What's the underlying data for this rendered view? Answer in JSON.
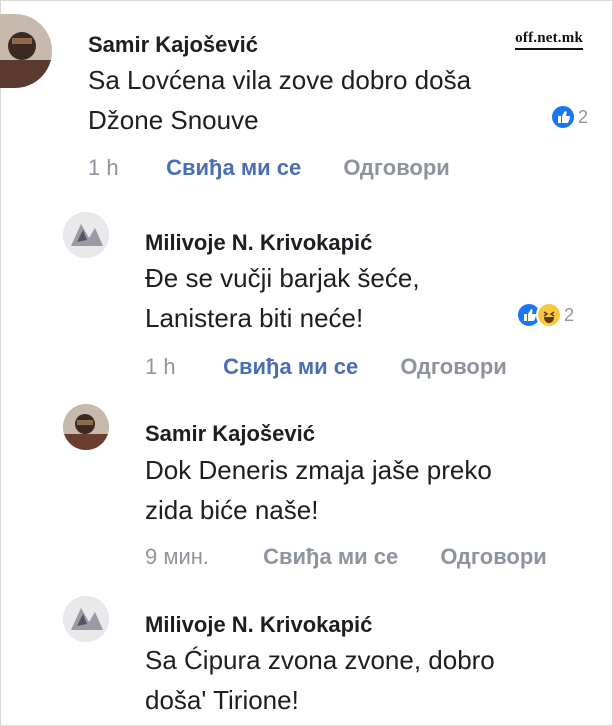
{
  "watermark": "off.net.mk",
  "comments": [
    {
      "author": "Samir Kajošević",
      "lines": [
        "Sa Lovćena vila zove dobro doša",
        "Džone Snouve"
      ],
      "time": "1 h",
      "like_label": "Свиђа ми се",
      "reply_label": "Одговори",
      "reactions": [
        "like-icon"
      ],
      "reaction_count": "2"
    },
    {
      "author": "Milivoje N. Krivokapić",
      "lines": [
        "Đe se vučji barjak šeće,",
        "Lanistera biti neće!"
      ],
      "time": "1 h",
      "like_label": "Свиђа ми се",
      "reply_label": "Одговори",
      "reactions": [
        "like-icon",
        "haha-icon"
      ],
      "reaction_count": "2"
    },
    {
      "author": "Samir Kajošević",
      "lines": [
        "Dok Deneris zmaja jaše preko",
        "zida biće naše!"
      ],
      "time": "9 мин.",
      "like_label": "Свиђа ми се",
      "reply_label": "Одговори"
    },
    {
      "author": "Milivoje N. Krivokapić",
      "lines": [
        "Sa Ćipura zvona zvone, dobro",
        "doša' Tirione!"
      ]
    }
  ],
  "colors": {
    "like_blue": "#4a6eb5",
    "reaction_blue": "#1877f2",
    "haha_yellow": "#f7c73d"
  }
}
